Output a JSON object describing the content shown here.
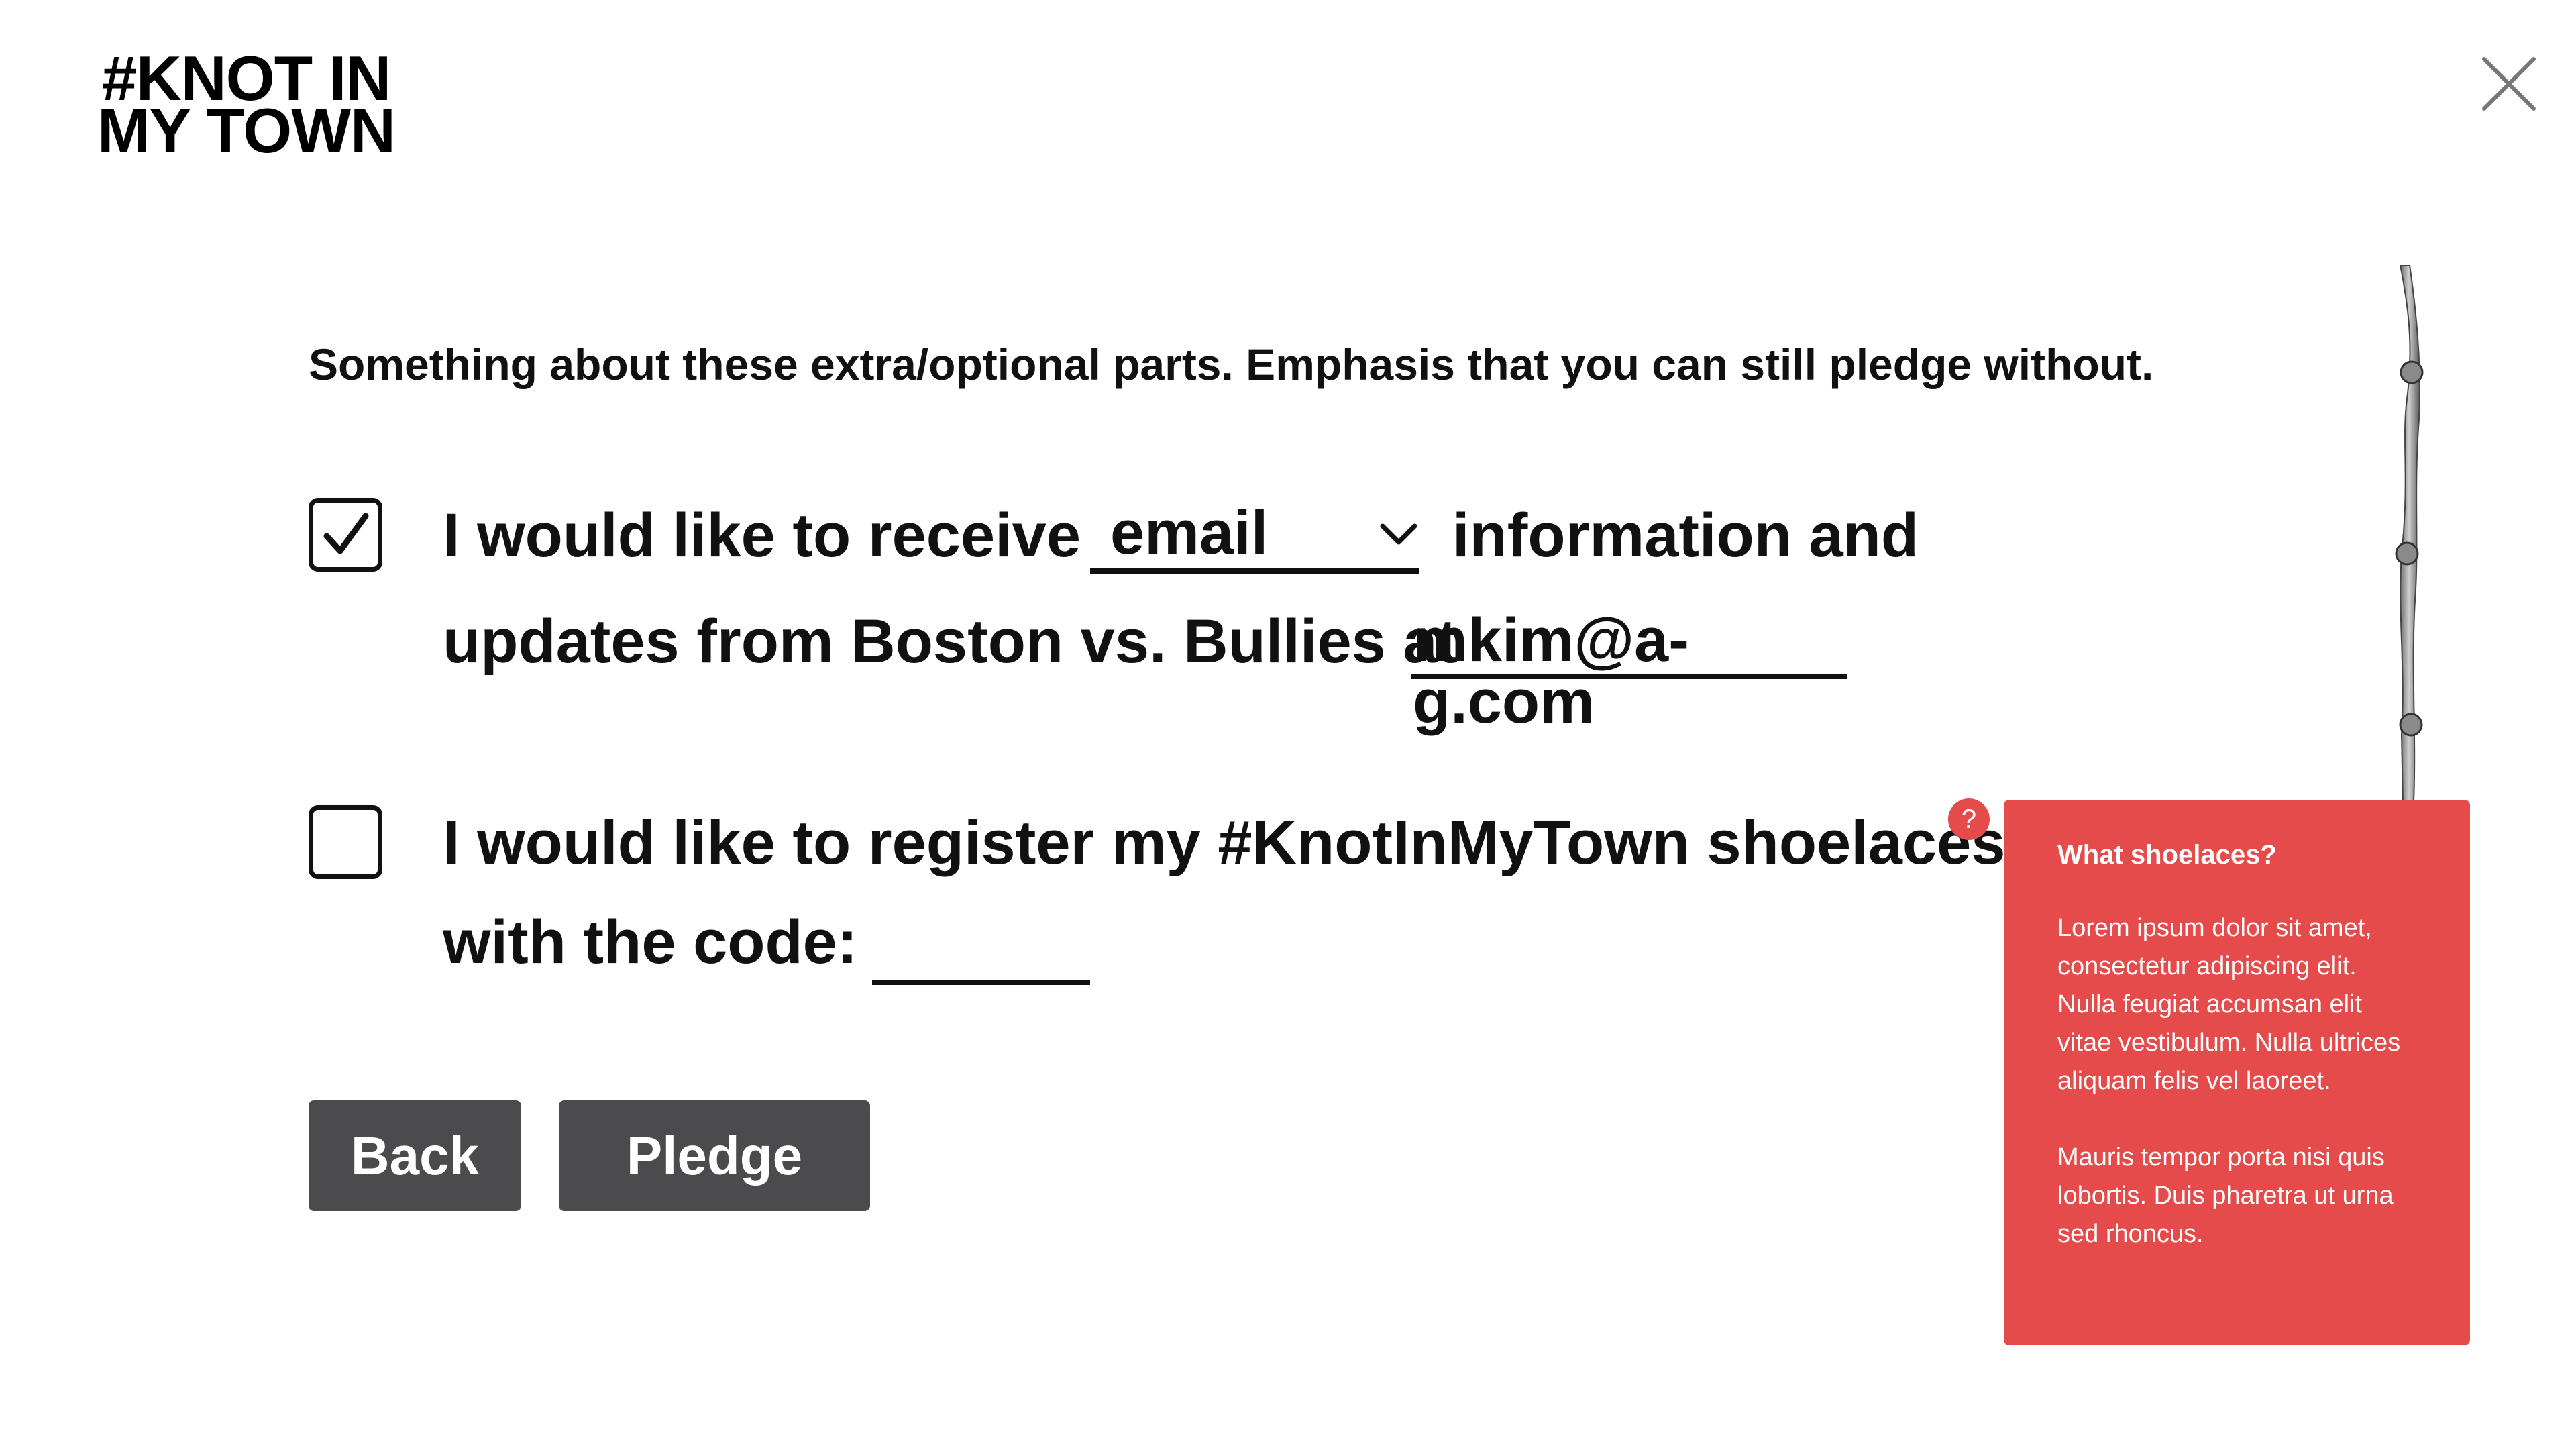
{
  "logo": {
    "line1": "#KNOT IN",
    "line2": "MY TOWN"
  },
  "close_label": "Close",
  "intro": "Something about these extra/optional parts. Emphasis that you can still pledge without.",
  "email_optin": {
    "checked": true,
    "text_before": "I would like to receive",
    "select_value": "email",
    "text_after": "information and",
    "line2_text": "updates from Boston vs. Bullies at",
    "email_value": "mkim@a-g.com"
  },
  "shoelaces": {
    "checked": false,
    "line1": "I would like to register my #KnotInMyTown shoelaces",
    "line2": "with the code:",
    "code_value": "",
    "help_icon": "?"
  },
  "buttons": {
    "back": "Back",
    "pledge": "Pledge"
  },
  "tooltip": {
    "title": "What shoelaces?",
    "paragraph1": "Lorem ipsum dolor sit amet, consectetur adipiscing elit. Nulla feugiat accumsan elit vitae vestibulum. Nulla ultrices aliquam felis vel laoreet.",
    "paragraph2": "Mauris tempor porta nisi quis lobortis. Duis pharetra ut urna sed rhoncus."
  },
  "colors": {
    "accent": "#e54b4b",
    "button": "#4b4b4d",
    "text": "#111111"
  },
  "icons": [
    "close-icon",
    "checkmark-icon",
    "chevron-down-icon",
    "help-icon",
    "rope-icon"
  ]
}
